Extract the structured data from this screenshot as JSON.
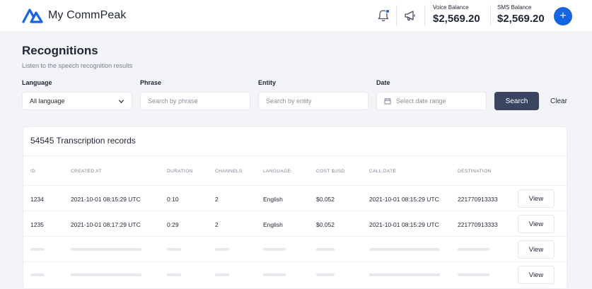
{
  "app": {
    "name": "My CommPeak"
  },
  "header": {
    "voice_balance_label": "Voice Balance",
    "voice_balance_value": "$2,569.20",
    "sms_balance_label": "SMS Balance",
    "sms_balance_value": "$2,569.20",
    "add_button": "+"
  },
  "page": {
    "title": "Recognitions",
    "subtitle": "Listen to the speech recognition results"
  },
  "filters": {
    "language_label": "Language",
    "language_value": "All language",
    "phrase_label": "Phrase",
    "phrase_placeholder": "Search by phrase",
    "entity_label": "Entity",
    "entity_placeholder": "Search by entity",
    "date_label": "Date",
    "date_placeholder": "Select date range",
    "search_button": "Search",
    "clear_button": "Clear"
  },
  "table": {
    "title": "54545 Transcription records",
    "columns": [
      "ID",
      "CREATED AT",
      "DURATION",
      "CHANNELS",
      "LANGUAGE",
      "COST $USD",
      "CALL DATE",
      "DESTINATION"
    ],
    "rows": [
      [
        "1234",
        "2021-10-01 08:15:29 UTC",
        "0:10",
        "2",
        "English",
        "$0.052",
        "2021-10-01 08:15:29 UTC",
        "221770913333"
      ],
      [
        "1235",
        "2021-10-01 08:17:29 UTC",
        "0:29",
        "2",
        "English",
        "$0.052",
        "2021-10-01 08:15:29 UTC",
        "221770913333"
      ]
    ],
    "view_label": "View"
  },
  "colors": {
    "accent": "#1565e0",
    "search_button": "#3a4461",
    "background": "#f3f4f8"
  },
  "icons": [
    "commpeak-logo",
    "bell-icon",
    "megaphone-icon",
    "plus-icon",
    "chevron-down-icon",
    "calendar-icon"
  ]
}
